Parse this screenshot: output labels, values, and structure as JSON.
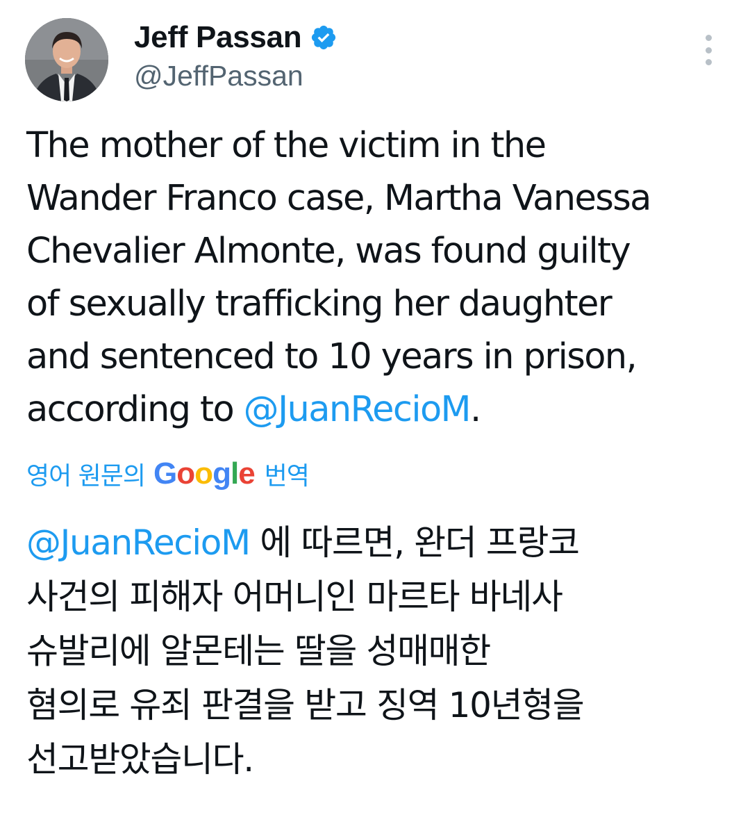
{
  "author": {
    "display_name": "Jeff Passan",
    "handle": "@JeffPassan",
    "verified": true,
    "avatar_icon": "avatar-icon"
  },
  "colors": {
    "link": "#1d9bf0",
    "text": "#0f1419",
    "secondary": "#536471",
    "verified_badge": "#1d9bf0"
  },
  "tweet": {
    "lines": [
      {
        "text": "The mother of the victim in the",
        "mention": "",
        "tail": ""
      },
      {
        "text": "Wander Franco case, Martha Vanessa",
        "mention": "",
        "tail": ""
      },
      {
        "text": "Chevalier Almonte, was found guilty",
        "mention": "",
        "tail": ""
      },
      {
        "text": "of sexually trafficking her daughter",
        "mention": "",
        "tail": ""
      },
      {
        "text": "and sentenced to 10 years in prison,",
        "mention": "",
        "tail": ""
      },
      {
        "text": "according to ",
        "mention": "@JuanRecioM",
        "tail": "."
      }
    ]
  },
  "translate": {
    "prefix": "영어 원문의",
    "logo_letters": [
      "G",
      "o",
      "o",
      "g",
      "l",
      "e"
    ],
    "suffix": "번역"
  },
  "translation": {
    "lines": [
      {
        "mention": "@JuanRecioM",
        "text": " 에 따르면, 완더 프랑코"
      },
      {
        "mention": "",
        "text": "사건의 피해자 어머니인 마르타 바네사"
      },
      {
        "mention": "",
        "text": "슈발리에 알몬테는 딸을 성매매한"
      },
      {
        "mention": "",
        "text": "혐의로 유죄 판결을 받고 징역 10년형을"
      },
      {
        "mention": "",
        "text": "선고받았습니다."
      }
    ]
  }
}
